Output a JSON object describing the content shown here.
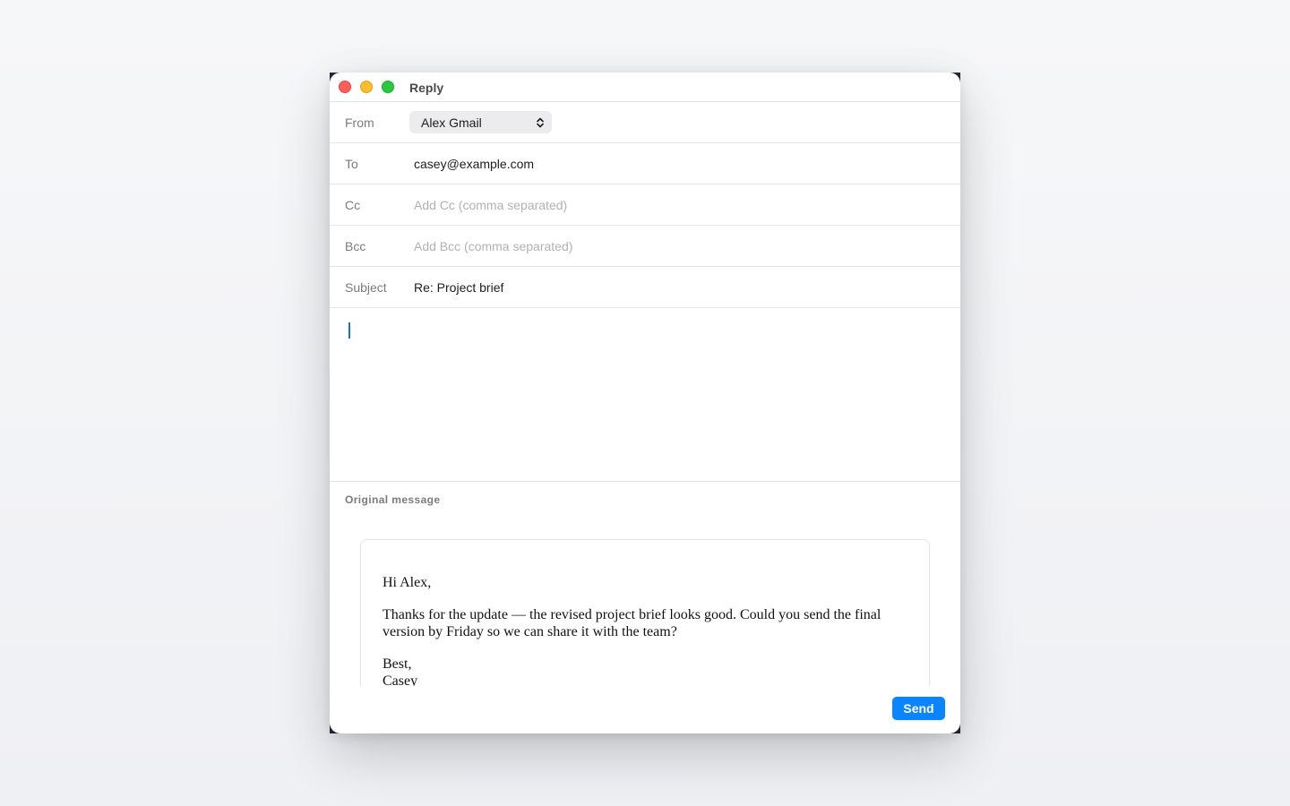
{
  "window": {
    "title": "Reply"
  },
  "fields": {
    "from": {
      "label": "From",
      "value": "Alex Gmail"
    },
    "to": {
      "label": "To",
      "value": "casey@example.com"
    },
    "cc": {
      "label": "Cc",
      "placeholder": "Add Cc (comma separated)"
    },
    "bcc": {
      "label": "Bcc",
      "placeholder": "Add Bcc (comma separated)"
    },
    "subject": {
      "label": "Subject",
      "value": "Re: Project brief"
    }
  },
  "original_message": {
    "label": "Original message",
    "greeting": "Hi Alex,",
    "body": "Thanks for the update — the revised project brief looks good. Could you send the final version by Friday so we can share it with the team?",
    "closing": "Best,",
    "signature": "Casey"
  },
  "actions": {
    "send_label": "Send"
  },
  "colors": {
    "accent": "#0a84ff",
    "caret": "#1a6fe6",
    "close": "#fe5f57",
    "minimize": "#febc2e",
    "zoom": "#28c840"
  }
}
